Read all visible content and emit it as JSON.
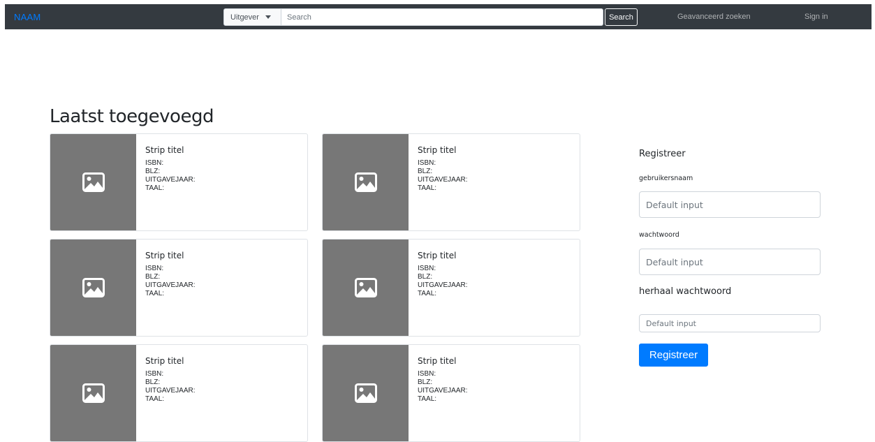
{
  "navbar": {
    "brand": "NAAM",
    "filter_label": "Uitgever",
    "search_placeholder": "Search",
    "search_button": "Search",
    "advanced_search": "Geavanceerd zoeken",
    "sign_in": "Sign in"
  },
  "main": {
    "section_title": "Laatst toegevoegd",
    "cards": [
      {
        "title": "Strip titel",
        "isbn": "ISBN:",
        "blz": "BLZ:",
        "year": "UITGAVEJAAR:",
        "lang": "TAAL:"
      },
      {
        "title": "Strip titel",
        "isbn": "ISBN:",
        "blz": "BLZ:",
        "year": "UITGAVEJAAR:",
        "lang": "TAAL:"
      },
      {
        "title": "Strip titel",
        "isbn": "ISBN:",
        "blz": "BLZ:",
        "year": "UITGAVEJAAR:",
        "lang": "TAAL:"
      },
      {
        "title": "Strip titel",
        "isbn": "ISBN:",
        "blz": "BLZ:",
        "year": "UITGAVEJAAR:",
        "lang": "TAAL:"
      },
      {
        "title": "Strip titel",
        "isbn": "ISBN:",
        "blz": "BLZ:",
        "year": "UITGAVEJAAR:",
        "lang": "TAAL:"
      },
      {
        "title": "Strip titel",
        "isbn": "ISBN:",
        "blz": "BLZ:",
        "year": "UITGAVEJAAR:",
        "lang": "TAAL:"
      }
    ],
    "card_image_icon": "image-icon"
  },
  "register": {
    "heading": "Registreer",
    "username_label": "gebruikersnaam",
    "username_placeholder": "Default input",
    "password_label": "wachtwoord",
    "password_placeholder": "Default input",
    "repeat_label": "herhaal wachtwoord",
    "repeat_placeholder": "Default input",
    "submit_label": "Registreer"
  },
  "colors": {
    "navbar_bg": "#343a40",
    "brand": "#007bff",
    "primary": "#007bff",
    "image_placeholder": "#777777"
  }
}
